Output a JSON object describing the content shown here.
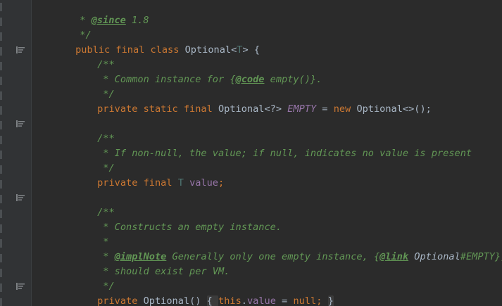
{
  "editor": {
    "language": "java",
    "colors": {
      "background": "#2b2b2b",
      "gutter": "#313335",
      "keyword": "#cc7832",
      "doc_comment": "#629755",
      "field": "#9876aa",
      "type_param": "#507874",
      "text": "#a9b7c6"
    },
    "lines": {
      "l1": {
        "a": " * ",
        "b": "@since",
        "c": " 1.8"
      },
      "l2": {
        "a": " */"
      },
      "l3": {
        "a": "public final class ",
        "b": "Optional<",
        "c": "T",
        "d": "> {"
      },
      "l4": {
        "a": "/**"
      },
      "l5": {
        "a": " * Common instance for {",
        "b": "@code",
        "c": " empty()}."
      },
      "l6": {
        "a": " */"
      },
      "l7": {
        "a": "private static final ",
        "b": "Optional<?> ",
        "c": "EMPTY",
        "d": " = ",
        "e": "new ",
        "f": "Optional<>();"
      },
      "l8": {
        "a": "/**"
      },
      "l9": {
        "a": " * If non-null, the value; if null, indicates no value is present"
      },
      "l10": {
        "a": " */"
      },
      "l11": {
        "a": "private final ",
        "b": "T ",
        "c": "value",
        "d": ";"
      },
      "l12": {
        "a": "/**"
      },
      "l13": {
        "a": " * Constructs an empty instance."
      },
      "l14": {
        "a": " *"
      },
      "l15": {
        "a": " * ",
        "b": "@implNote",
        "c": " Generally only one empty instance, {",
        "d": "@link",
        "e": " Optional",
        "f": "#EMPTY},",
        "g": ""
      },
      "l16": {
        "a": " * should exist per VM."
      },
      "l17": {
        "a": " */"
      },
      "l18": {
        "a": "private ",
        "b": "Optional",
        "c": "() ",
        "d": "{ ",
        "e": "this",
        "f": ".",
        "g": "value",
        "h": " = ",
        "i": "null",
        "j": "; ",
        "k": "}"
      }
    },
    "gutter_icons": [
      "implemented-icon",
      "implemented-icon",
      "implemented-icon",
      "implemented-icon"
    ]
  }
}
